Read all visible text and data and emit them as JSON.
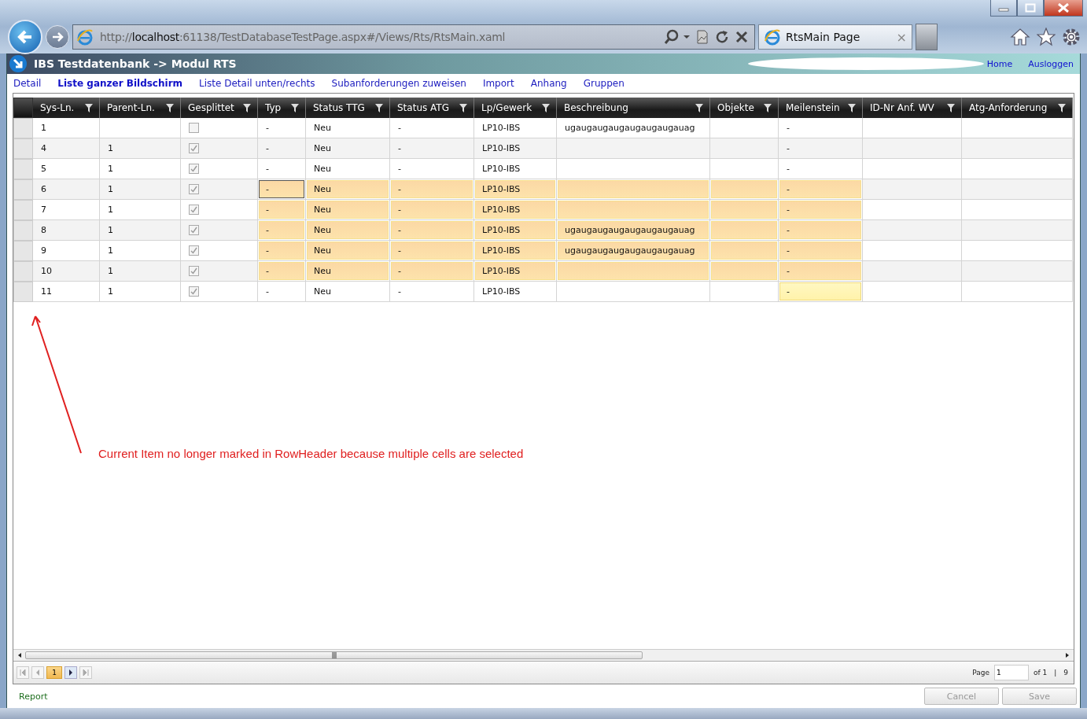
{
  "browser": {
    "url_scheme": "http://",
    "url_host": "localhost",
    "url_path": ":61138/TestDatabaseTestPage.aspx#/Views/Rts/RtsMain.xaml",
    "tab": {
      "title": "RtsMain Page",
      "close": "×"
    }
  },
  "app": {
    "title": "IBS Testdatenbank -> Modul RTS",
    "links": [
      "Home",
      "Ausloggen"
    ]
  },
  "nav": [
    {
      "label": "Detail",
      "selected": false
    },
    {
      "label": "Liste ganzer Bildschirm",
      "selected": true
    },
    {
      "label": "Liste Detail unten/rechts",
      "selected": false
    },
    {
      "label": "Subanforderungen zuweisen",
      "selected": false
    },
    {
      "label": "Import",
      "selected": false
    },
    {
      "label": "Anhang",
      "selected": false
    },
    {
      "label": "Gruppen",
      "selected": false
    }
  ],
  "grid": {
    "columns": [
      {
        "label": "Sys-Ln.",
        "kind": "text"
      },
      {
        "label": "Parent-Ln.",
        "kind": "text"
      },
      {
        "label": "Gesplittet",
        "kind": "check"
      },
      {
        "label": "Typ",
        "kind": "text"
      },
      {
        "label": "Status TTG",
        "kind": "text"
      },
      {
        "label": "Status ATG",
        "kind": "text"
      },
      {
        "label": "Lp/Gewerk",
        "kind": "text"
      },
      {
        "label": "Beschreibung",
        "kind": "text"
      },
      {
        "label": "Objekte",
        "kind": "text"
      },
      {
        "label": "Meilenstein",
        "kind": "text"
      },
      {
        "label": "ID-Nr Anf. WV",
        "kind": "text"
      },
      {
        "label": "Atg-Anforderung",
        "kind": "text"
      }
    ],
    "rows": [
      {
        "cells": [
          {
            "text": "1",
            "selected": false,
            "focused": false,
            "current": false
          },
          {
            "selected": false,
            "focused": false,
            "current": false
          },
          {
            "checked": false,
            "selected": false,
            "focused": false,
            "current": false
          },
          {
            "text": "-",
            "selected": false,
            "focused": false,
            "current": false
          },
          {
            "text": "Neu",
            "selected": false,
            "focused": false,
            "current": false
          },
          {
            "text": "-",
            "selected": false,
            "focused": false,
            "current": false
          },
          {
            "text": "LP10-IBS",
            "selected": false,
            "focused": false,
            "current": false
          },
          {
            "text": "ugaugaugaugaugaugaugauag",
            "selected": false,
            "focused": false,
            "current": false
          },
          {
            "selected": false,
            "focused": false,
            "current": false
          },
          {
            "text": "-",
            "selected": false,
            "focused": false,
            "current": false
          },
          {
            "selected": false,
            "focused": false,
            "current": false
          },
          {
            "selected": false,
            "focused": false,
            "current": false
          }
        ]
      },
      {
        "cells": [
          {
            "text": "4",
            "selected": false,
            "focused": false,
            "current": false
          },
          {
            "text": "1",
            "selected": false,
            "focused": false,
            "current": false
          },
          {
            "checked": true,
            "selected": false,
            "focused": false,
            "current": false
          },
          {
            "text": "-",
            "selected": false,
            "focused": false,
            "current": false
          },
          {
            "text": "Neu",
            "selected": false,
            "focused": false,
            "current": false
          },
          {
            "text": "-",
            "selected": false,
            "focused": false,
            "current": false
          },
          {
            "text": "LP10-IBS",
            "selected": false,
            "focused": false,
            "current": false
          },
          {
            "selected": false,
            "focused": false,
            "current": false
          },
          {
            "selected": false,
            "focused": false,
            "current": false
          },
          {
            "text": "-",
            "selected": false,
            "focused": false,
            "current": false
          },
          {
            "selected": false,
            "focused": false,
            "current": false
          },
          {
            "selected": false,
            "focused": false,
            "current": false
          }
        ]
      },
      {
        "cells": [
          {
            "text": "5",
            "selected": false,
            "focused": false,
            "current": false
          },
          {
            "text": "1",
            "selected": false,
            "focused": false,
            "current": false
          },
          {
            "checked": true,
            "selected": false,
            "focused": false,
            "current": false
          },
          {
            "text": "-",
            "selected": false,
            "focused": false,
            "current": false
          },
          {
            "text": "Neu",
            "selected": false,
            "focused": false,
            "current": false
          },
          {
            "text": "-",
            "selected": false,
            "focused": false,
            "current": false
          },
          {
            "text": "LP10-IBS",
            "selected": false,
            "focused": false,
            "current": false
          },
          {
            "selected": false,
            "focused": false,
            "current": false
          },
          {
            "selected": false,
            "focused": false,
            "current": false
          },
          {
            "text": "-",
            "selected": false,
            "focused": false,
            "current": false
          },
          {
            "selected": false,
            "focused": false,
            "current": false
          },
          {
            "selected": false,
            "focused": false,
            "current": false
          }
        ]
      },
      {
        "cells": [
          {
            "text": "6",
            "selected": false,
            "focused": false,
            "current": false
          },
          {
            "text": "1",
            "selected": false,
            "focused": false,
            "current": false
          },
          {
            "checked": true,
            "selected": false,
            "focused": false,
            "current": false
          },
          {
            "text": "-",
            "selected": true,
            "focused": true,
            "current": false
          },
          {
            "text": "Neu",
            "selected": true,
            "focused": false,
            "current": false
          },
          {
            "text": "-",
            "selected": true,
            "focused": false,
            "current": false
          },
          {
            "text": "LP10-IBS",
            "selected": true,
            "focused": false,
            "current": false
          },
          {
            "selected": true,
            "focused": false,
            "current": false
          },
          {
            "selected": true,
            "focused": false,
            "current": false
          },
          {
            "text": "-",
            "selected": true,
            "focused": false,
            "current": false
          },
          {
            "selected": false,
            "focused": false,
            "current": false
          },
          {
            "selected": false,
            "focused": false,
            "current": false
          }
        ]
      },
      {
        "cells": [
          {
            "text": "7",
            "selected": false,
            "focused": false,
            "current": false
          },
          {
            "text": "1",
            "selected": false,
            "focused": false,
            "current": false
          },
          {
            "checked": true,
            "selected": false,
            "focused": false,
            "current": false
          },
          {
            "text": "-",
            "selected": true,
            "focused": false,
            "current": false
          },
          {
            "text": "Neu",
            "selected": true,
            "focused": false,
            "current": false
          },
          {
            "text": "-",
            "selected": true,
            "focused": false,
            "current": false
          },
          {
            "text": "LP10-IBS",
            "selected": true,
            "focused": false,
            "current": false
          },
          {
            "selected": true,
            "focused": false,
            "current": false
          },
          {
            "selected": true,
            "focused": false,
            "current": false
          },
          {
            "text": "-",
            "selected": true,
            "focused": false,
            "current": false
          },
          {
            "selected": false,
            "focused": false,
            "current": false
          },
          {
            "selected": false,
            "focused": false,
            "current": false
          }
        ]
      },
      {
        "cells": [
          {
            "text": "8",
            "selected": false,
            "focused": false,
            "current": false
          },
          {
            "text": "1",
            "selected": false,
            "focused": false,
            "current": false
          },
          {
            "checked": true,
            "selected": false,
            "focused": false,
            "current": false
          },
          {
            "text": "-",
            "selected": true,
            "focused": false,
            "current": false
          },
          {
            "text": "Neu",
            "selected": true,
            "focused": false,
            "current": false
          },
          {
            "text": "-",
            "selected": true,
            "focused": false,
            "current": false
          },
          {
            "text": "LP10-IBS",
            "selected": true,
            "focused": false,
            "current": false
          },
          {
            "text": "ugaugaugaugaugaugaugauag",
            "selected": true,
            "focused": false,
            "current": false
          },
          {
            "selected": true,
            "focused": false,
            "current": false
          },
          {
            "text": "-",
            "selected": true,
            "focused": false,
            "current": false
          },
          {
            "selected": false,
            "focused": false,
            "current": false
          },
          {
            "selected": false,
            "focused": false,
            "current": false
          }
        ]
      },
      {
        "cells": [
          {
            "text": "9",
            "selected": false,
            "focused": false,
            "current": false
          },
          {
            "text": "1",
            "selected": false,
            "focused": false,
            "current": false
          },
          {
            "checked": true,
            "selected": false,
            "focused": false,
            "current": false
          },
          {
            "text": "-",
            "selected": true,
            "focused": false,
            "current": false
          },
          {
            "text": "Neu",
            "selected": true,
            "focused": false,
            "current": false
          },
          {
            "text": "-",
            "selected": true,
            "focused": false,
            "current": false
          },
          {
            "text": "LP10-IBS",
            "selected": true,
            "focused": false,
            "current": false
          },
          {
            "text": "ugaugaugaugaugaugaugauag",
            "selected": true,
            "focused": false,
            "current": false
          },
          {
            "selected": true,
            "focused": false,
            "current": false
          },
          {
            "text": "-",
            "selected": true,
            "focused": false,
            "current": false
          },
          {
            "selected": false,
            "focused": false,
            "current": false
          },
          {
            "selected": false,
            "focused": false,
            "current": false
          }
        ]
      },
      {
        "cells": [
          {
            "text": "10",
            "selected": false,
            "focused": false,
            "current": false
          },
          {
            "text": "1",
            "selected": false,
            "focused": false,
            "current": false
          },
          {
            "checked": true,
            "selected": false,
            "focused": false,
            "current": false
          },
          {
            "text": "-",
            "selected": true,
            "focused": false,
            "current": false
          },
          {
            "text": "Neu",
            "selected": true,
            "focused": false,
            "current": false
          },
          {
            "text": "-",
            "selected": true,
            "focused": false,
            "current": false
          },
          {
            "text": "LP10-IBS",
            "selected": true,
            "focused": false,
            "current": false
          },
          {
            "selected": true,
            "focused": false,
            "current": false
          },
          {
            "selected": true,
            "focused": false,
            "current": false
          },
          {
            "text": "-",
            "selected": true,
            "focused": false,
            "current": false
          },
          {
            "selected": false,
            "focused": false,
            "current": false
          },
          {
            "selected": false,
            "focused": false,
            "current": false
          }
        ]
      },
      {
        "cells": [
          {
            "text": "11",
            "selected": false,
            "focused": false,
            "current": false
          },
          {
            "text": "1",
            "selected": false,
            "focused": false,
            "current": false
          },
          {
            "checked": true,
            "selected": false,
            "focused": false,
            "current": false
          },
          {
            "text": "-",
            "selected": false,
            "focused": false,
            "current": false
          },
          {
            "text": "Neu",
            "selected": false,
            "focused": false,
            "current": false
          },
          {
            "text": "-",
            "selected": false,
            "focused": false,
            "current": false
          },
          {
            "text": "LP10-IBS",
            "selected": false,
            "focused": false,
            "current": false
          },
          {
            "selected": false,
            "focused": false,
            "current": false
          },
          {
            "selected": false,
            "focused": false,
            "current": false
          },
          {
            "text": "-",
            "selected": false,
            "focused": false,
            "current": true
          },
          {
            "selected": false,
            "focused": false,
            "current": false
          },
          {
            "selected": false,
            "focused": false,
            "current": false
          }
        ]
      }
    ]
  },
  "annotation": "Current Item no longer marked in RowHeader because multiple cells are selected",
  "pager": {
    "pages": [
      {
        "label": "1",
        "selected": true
      }
    ],
    "page_label": "Page",
    "page_value": "1",
    "of_label": "of 1",
    "separator": "|",
    "count": "9"
  },
  "footer": {
    "report": "Report",
    "buttons": [
      {
        "label": "Cancel",
        "disabled": true
      },
      {
        "label": "Save",
        "disabled": true
      }
    ]
  }
}
